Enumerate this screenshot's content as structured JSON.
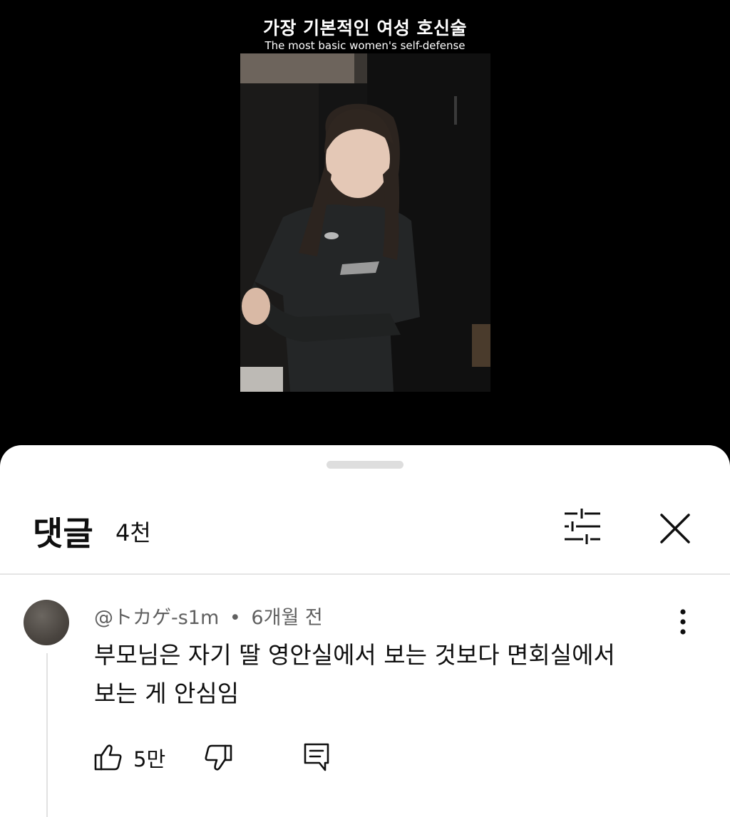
{
  "video": {
    "title": "가장 기본적인 여성 호신술",
    "subtitle": "The most basic women's self-defense"
  },
  "comments_panel": {
    "title": "댓글",
    "count": "4천",
    "filter_icon": "sort-filter-icon",
    "close_icon": "close-icon"
  },
  "comment": {
    "author": "@トカゲ-s1m",
    "separator": "•",
    "time": "6개월 전",
    "text_line1": "부모님은 자기 딸 영안실에서 보는 것보다 면회실에서",
    "text_line2": "보는 게 안심임",
    "likes": "5만",
    "icons": {
      "like": "thumbs-up-icon",
      "dislike": "thumbs-down-icon",
      "reply": "reply-icon",
      "more": "more-vertical-icon"
    }
  }
}
